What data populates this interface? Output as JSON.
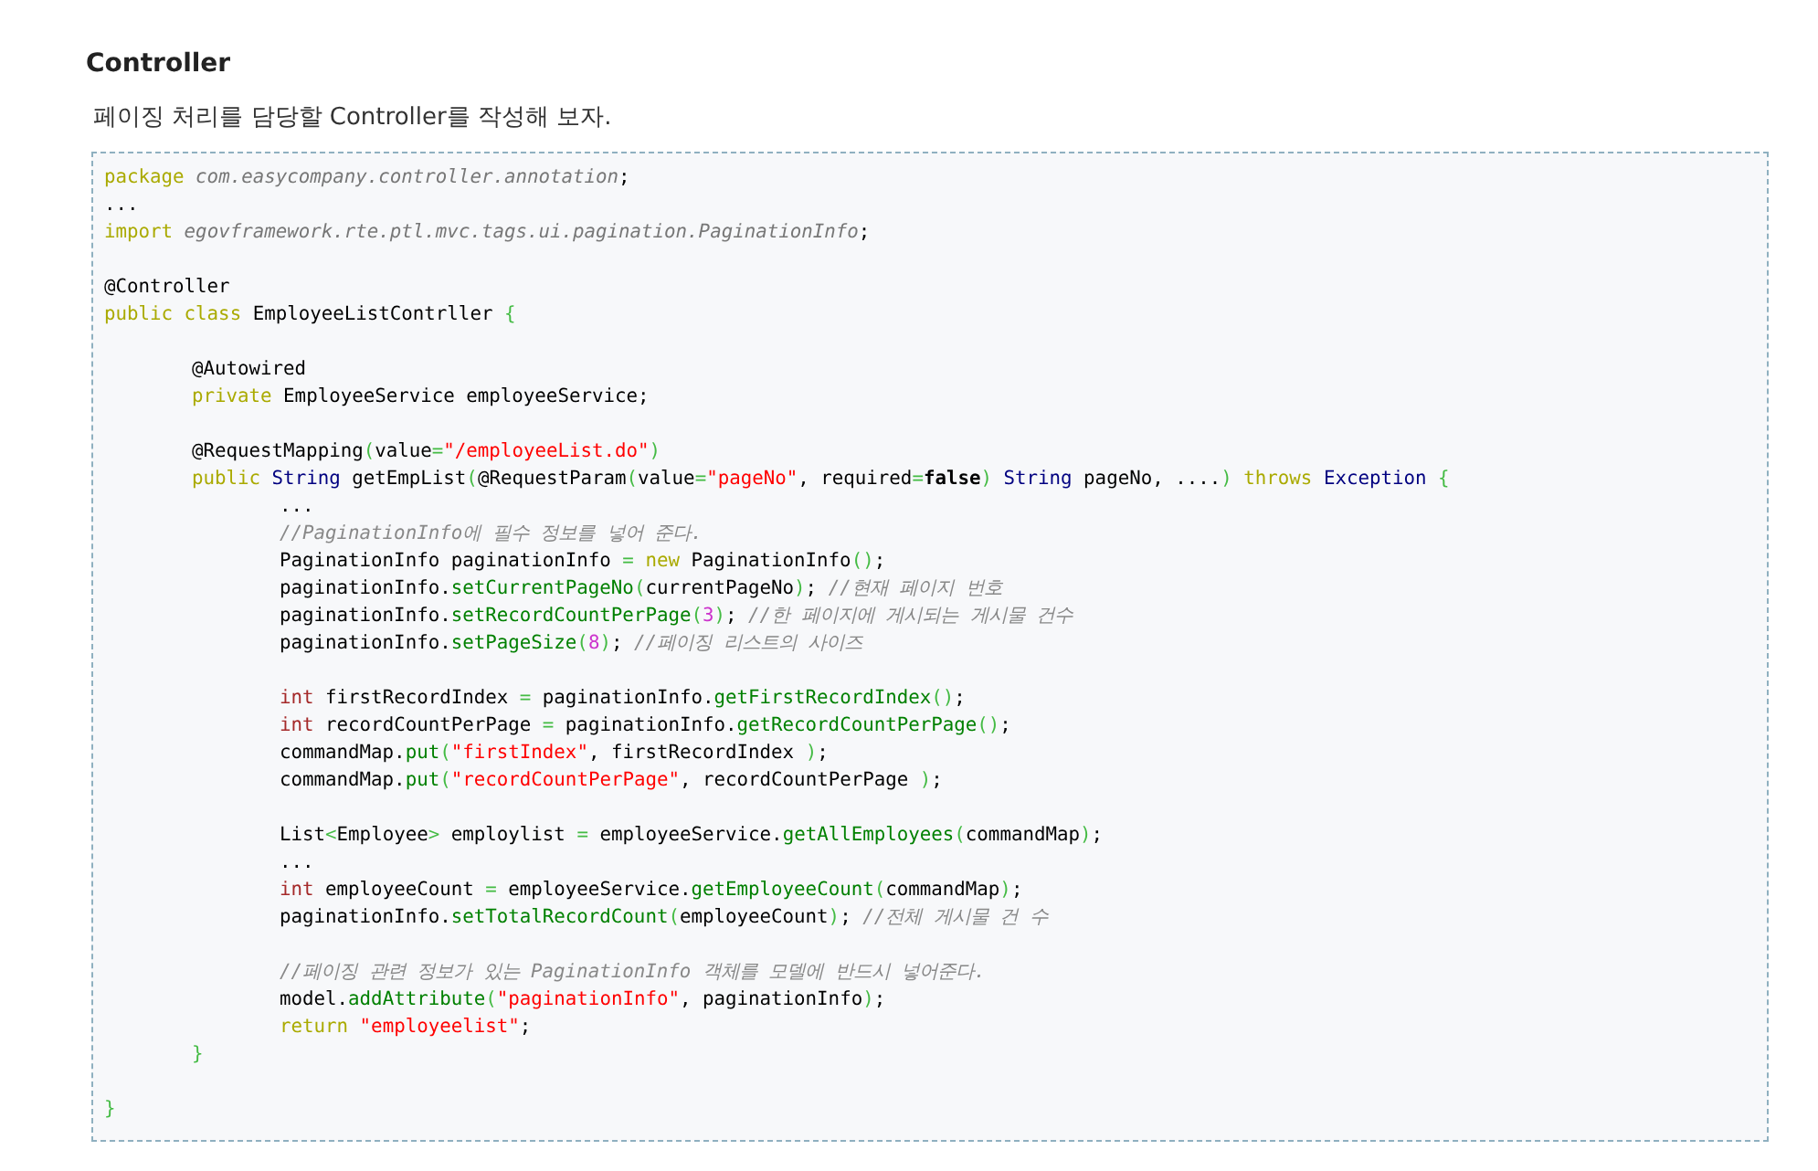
{
  "heading": "Controller",
  "intro": "페이징 처리를 담당할 Controller를 작성해 보자.",
  "code": {
    "lines": [
      {
        "kind": "top",
        "tokens": [
          {
            "kind": "keyword",
            "text": "package"
          },
          {
            "kind": "path",
            "text": " com.easycompany.controller.annotation"
          },
          {
            "kind": "plain",
            "text": ";"
          }
        ]
      },
      {
        "kind": "top",
        "tokens": [
          {
            "kind": "plain",
            "text": "..."
          }
        ]
      },
      {
        "kind": "top",
        "tokens": [
          {
            "kind": "keyword",
            "text": "import"
          },
          {
            "kind": "path",
            "text": " egovframework.rte.ptl.mvc.tags.ui.pagination.PaginationInfo"
          },
          {
            "kind": "plain",
            "text": ";"
          }
        ]
      },
      {
        "kind": "blank"
      },
      {
        "kind": "top",
        "tokens": [
          {
            "kind": "plain",
            "text": "@Controller"
          }
        ]
      },
      {
        "kind": "top",
        "tokens": [
          {
            "kind": "keyword",
            "text": "public class"
          },
          {
            "kind": "plain",
            "text": " EmployeeListContrller "
          },
          {
            "kind": "operator",
            "text": "{"
          }
        ]
      },
      {
        "kind": "blank"
      },
      {
        "kind": "member",
        "tokens": [
          {
            "kind": "plain",
            "text": "@Autowired"
          }
        ]
      },
      {
        "kind": "member",
        "tokens": [
          {
            "kind": "keyword",
            "text": "private"
          },
          {
            "kind": "plain",
            "text": " EmployeeService employeeService;"
          }
        ]
      },
      {
        "kind": "blank"
      },
      {
        "kind": "member",
        "tokens": [
          {
            "kind": "plain",
            "text": "@RequestMapping"
          },
          {
            "kind": "operator",
            "text": "("
          },
          {
            "kind": "plain",
            "text": "value"
          },
          {
            "kind": "operator",
            "text": "="
          },
          {
            "kind": "string",
            "text": "\"/employeeList.do\""
          },
          {
            "kind": "operator",
            "text": ")"
          }
        ]
      },
      {
        "kind": "member",
        "tokens": [
          {
            "kind": "keyword",
            "text": "public"
          },
          {
            "kind": "type",
            "text": " String"
          },
          {
            "kind": "plain",
            "text": " getEmpList"
          },
          {
            "kind": "operator",
            "text": "("
          },
          {
            "kind": "plain",
            "text": "@RequestParam"
          },
          {
            "kind": "operator",
            "text": "("
          },
          {
            "kind": "plain",
            "text": "value"
          },
          {
            "kind": "operator",
            "text": "="
          },
          {
            "kind": "string",
            "text": "\"pageNo\""
          },
          {
            "kind": "plain",
            "text": ", required"
          },
          {
            "kind": "operator",
            "text": "="
          },
          {
            "kind": "bold",
            "text": "false"
          },
          {
            "kind": "operator",
            "text": ")"
          },
          {
            "kind": "type",
            "text": " String"
          },
          {
            "kind": "plain",
            "text": " pageNo, ...."
          },
          {
            "kind": "operator",
            "text": ")"
          },
          {
            "kind": "keyword",
            "text": " throws"
          },
          {
            "kind": "type",
            "text": " Exception"
          },
          {
            "kind": "operator",
            "text": " {"
          }
        ]
      },
      {
        "kind": "statement",
        "tokens": [
          {
            "kind": "plain",
            "text": "..."
          }
        ]
      },
      {
        "kind": "statement",
        "tokens": [
          {
            "kind": "comment",
            "text": "//PaginationInfo에 필수 정보를 넣어 준다."
          }
        ]
      },
      {
        "kind": "statement",
        "tokens": [
          {
            "kind": "plain",
            "text": "PaginationInfo paginationInfo "
          },
          {
            "kind": "operator",
            "text": "="
          },
          {
            "kind": "keyword",
            "text": " new"
          },
          {
            "kind": "plain",
            "text": " PaginationInfo"
          },
          {
            "kind": "operator",
            "text": "()"
          },
          {
            "kind": "plain",
            "text": ";"
          }
        ]
      },
      {
        "kind": "statement",
        "tokens": [
          {
            "kind": "plain",
            "text": "paginationInfo."
          },
          {
            "kind": "method",
            "text": "setCurrentPageNo"
          },
          {
            "kind": "operator",
            "text": "("
          },
          {
            "kind": "plain",
            "text": "currentPageNo"
          },
          {
            "kind": "operator",
            "text": ")"
          },
          {
            "kind": "plain",
            "text": ";"
          },
          {
            "kind": "comment",
            "text": " //현재 페이지 번호"
          }
        ]
      },
      {
        "kind": "statement",
        "tokens": [
          {
            "kind": "plain",
            "text": "paginationInfo."
          },
          {
            "kind": "method",
            "text": "setRecordCountPerPage"
          },
          {
            "kind": "operator",
            "text": "("
          },
          {
            "kind": "number",
            "text": "3"
          },
          {
            "kind": "operator",
            "text": ")"
          },
          {
            "kind": "plain",
            "text": ";"
          },
          {
            "kind": "comment",
            "text": " //한 페이지에 게시되는 게시물 건수"
          }
        ]
      },
      {
        "kind": "statement",
        "tokens": [
          {
            "kind": "plain",
            "text": "paginationInfo."
          },
          {
            "kind": "method",
            "text": "setPageSize"
          },
          {
            "kind": "operator",
            "text": "("
          },
          {
            "kind": "number",
            "text": "8"
          },
          {
            "kind": "operator",
            "text": ")"
          },
          {
            "kind": "plain",
            "text": ";"
          },
          {
            "kind": "comment",
            "text": " //페이징 리스트의 사이즈"
          }
        ]
      },
      {
        "kind": "blank"
      },
      {
        "kind": "statement",
        "tokens": [
          {
            "kind": "primitive",
            "text": "int"
          },
          {
            "kind": "plain",
            "text": " firstRecordIndex "
          },
          {
            "kind": "operator",
            "text": "="
          },
          {
            "kind": "plain",
            "text": " paginationInfo."
          },
          {
            "kind": "method",
            "text": "getFirstRecordIndex"
          },
          {
            "kind": "operator",
            "text": "()"
          },
          {
            "kind": "plain",
            "text": ";"
          }
        ]
      },
      {
        "kind": "statement",
        "tokens": [
          {
            "kind": "primitive",
            "text": "int"
          },
          {
            "kind": "plain",
            "text": " recordCountPerPage "
          },
          {
            "kind": "operator",
            "text": "="
          },
          {
            "kind": "plain",
            "text": " paginationInfo."
          },
          {
            "kind": "method",
            "text": "getRecordCountPerPage"
          },
          {
            "kind": "operator",
            "text": "()"
          },
          {
            "kind": "plain",
            "text": ";"
          }
        ]
      },
      {
        "kind": "statement",
        "tokens": [
          {
            "kind": "plain",
            "text": "commandMap."
          },
          {
            "kind": "method",
            "text": "put"
          },
          {
            "kind": "operator",
            "text": "("
          },
          {
            "kind": "string",
            "text": "\"firstIndex\""
          },
          {
            "kind": "plain",
            "text": ", firstRecordIndex "
          },
          {
            "kind": "operator",
            "text": ")"
          },
          {
            "kind": "plain",
            "text": ";"
          }
        ]
      },
      {
        "kind": "statement",
        "tokens": [
          {
            "kind": "plain",
            "text": "commandMap."
          },
          {
            "kind": "method",
            "text": "put"
          },
          {
            "kind": "operator",
            "text": "("
          },
          {
            "kind": "string",
            "text": "\"recordCountPerPage\""
          },
          {
            "kind": "plain",
            "text": ", recordCountPerPage "
          },
          {
            "kind": "operator",
            "text": ")"
          },
          {
            "kind": "plain",
            "text": ";"
          }
        ]
      },
      {
        "kind": "blank"
      },
      {
        "kind": "statement",
        "tokens": [
          {
            "kind": "plain",
            "text": "List"
          },
          {
            "kind": "operator",
            "text": "<"
          },
          {
            "kind": "plain",
            "text": "Employee"
          },
          {
            "kind": "operator",
            "text": ">"
          },
          {
            "kind": "plain",
            "text": " employlist "
          },
          {
            "kind": "operator",
            "text": "="
          },
          {
            "kind": "plain",
            "text": " employeeService."
          },
          {
            "kind": "method",
            "text": "getAllEmployees"
          },
          {
            "kind": "operator",
            "text": "("
          },
          {
            "kind": "plain",
            "text": "commandMap"
          },
          {
            "kind": "operator",
            "text": ")"
          },
          {
            "kind": "plain",
            "text": ";"
          }
        ]
      },
      {
        "kind": "statement",
        "tokens": [
          {
            "kind": "plain",
            "text": "..."
          }
        ]
      },
      {
        "kind": "statement",
        "tokens": [
          {
            "kind": "primitive",
            "text": "int"
          },
          {
            "kind": "plain",
            "text": " employeeCount "
          },
          {
            "kind": "operator",
            "text": "="
          },
          {
            "kind": "plain",
            "text": " employeeService."
          },
          {
            "kind": "method",
            "text": "getEmployeeCount"
          },
          {
            "kind": "operator",
            "text": "("
          },
          {
            "kind": "plain",
            "text": "commandMap"
          },
          {
            "kind": "operator",
            "text": ")"
          },
          {
            "kind": "plain",
            "text": ";"
          }
        ]
      },
      {
        "kind": "statement",
        "tokens": [
          {
            "kind": "plain",
            "text": "paginationInfo."
          },
          {
            "kind": "method",
            "text": "setTotalRecordCount"
          },
          {
            "kind": "operator",
            "text": "("
          },
          {
            "kind": "plain",
            "text": "employeeCount"
          },
          {
            "kind": "operator",
            "text": ")"
          },
          {
            "kind": "plain",
            "text": ";"
          },
          {
            "kind": "comment",
            "text": " //전체 게시물 건 수"
          }
        ]
      },
      {
        "kind": "blank"
      },
      {
        "kind": "statement",
        "tokens": [
          {
            "kind": "comment",
            "text": "//페이징 관련 정보가 있는 PaginationInfo 객체를 모델에 반드시 넣어준다."
          }
        ]
      },
      {
        "kind": "statement",
        "tokens": [
          {
            "kind": "plain",
            "text": "model."
          },
          {
            "kind": "method",
            "text": "addAttribute"
          },
          {
            "kind": "operator",
            "text": "("
          },
          {
            "kind": "string",
            "text": "\"paginationInfo\""
          },
          {
            "kind": "plain",
            "text": ", paginationInfo"
          },
          {
            "kind": "operator",
            "text": ")"
          },
          {
            "kind": "plain",
            "text": ";"
          }
        ]
      },
      {
        "kind": "statement",
        "tokens": [
          {
            "kind": "keyword",
            "text": "return"
          },
          {
            "kind": "string",
            "text": " \"employeelist\""
          },
          {
            "kind": "plain",
            "text": ";"
          }
        ]
      },
      {
        "kind": "member",
        "tokens": [
          {
            "kind": "operator",
            "text": "}"
          }
        ]
      },
      {
        "kind": "blank"
      },
      {
        "kind": "top",
        "tokens": [
          {
            "kind": "operator",
            "text": "}"
          }
        ]
      }
    ]
  }
}
